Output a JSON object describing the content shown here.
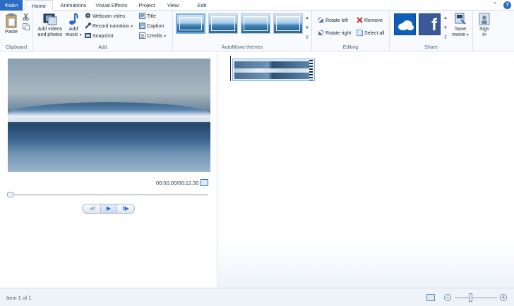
{
  "tabs": [
    "Файл",
    "Home",
    "Animations",
    "Visual Effects",
    "Project",
    "View",
    "Edit"
  ],
  "active_tab": "Home",
  "help_symbol": "?",
  "minimize_symbol": "⌃",
  "ribbon": {
    "clipboard": {
      "label": "Clipboard",
      "paste": "Paste",
      "cut_icon": "scissors-icon",
      "copy_icon": "copy-icon"
    },
    "add": {
      "label": "Add",
      "add_videos_line1": "Add videos",
      "add_videos_line2": "and photos",
      "add_music_line1": "Add",
      "add_music_line2": "music",
      "webcam_video": "Webcam video",
      "record_narration": "Record narration",
      "snapshot": "Snapshot",
      "title": "Title",
      "caption": "Caption",
      "credits": "Credits"
    },
    "automovie": {
      "label": "AutoMovie themes"
    },
    "editing": {
      "label": "Editing",
      "rotate_left": "Rotate left",
      "rotate_right": "Rotate right",
      "remove": "Remove",
      "select_all": "Select all"
    },
    "share": {
      "label": "Share",
      "save_movie_line1": "Save",
      "save_movie_line2": "movie",
      "sign_in_line1": "Sign",
      "sign_in_line2": "in",
      "facebook_letter": "f"
    }
  },
  "player": {
    "time": "00:00,00/00:12,30",
    "prev_symbol": "◀‖",
    "play_symbol": "▶",
    "next_symbol": "‖▶",
    "position": 0.0
  },
  "status": {
    "item_text": "Item 1 of 1",
    "zoom_out_symbol": "−",
    "zoom_in_symbol": "+",
    "zoom_level": 0.38
  },
  "colors": {
    "accent": "#2b6cc4",
    "onedrive": "#0f5fb8",
    "facebook": "#3b5998"
  }
}
